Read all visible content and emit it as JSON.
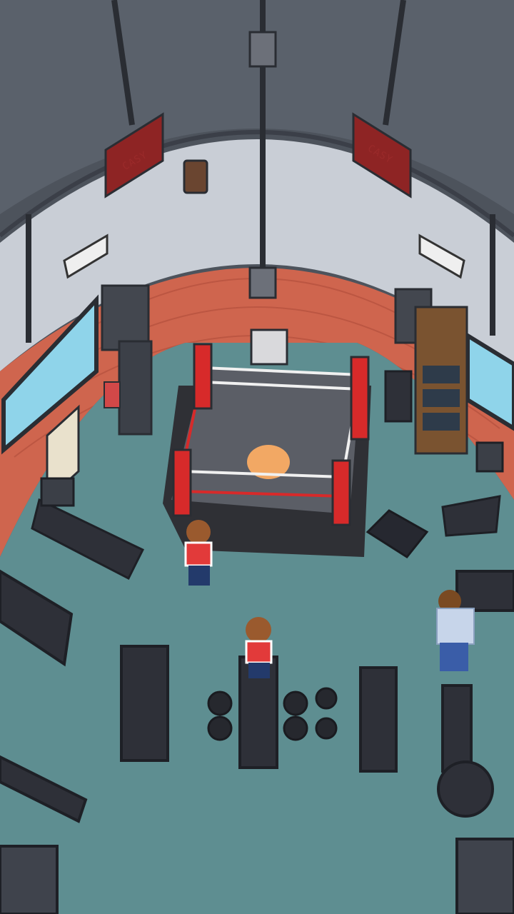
{
  "scene": {
    "type": "isometric-pixel-gym",
    "signs": [
      {
        "name": "left-wall-sign",
        "text": "CASY"
      },
      {
        "name": "right-wall-sign",
        "text": "CASY"
      }
    ],
    "colors": {
      "ceiling": "#555c66",
      "wall_upper": "#c9ced6",
      "brick": "#d0664f",
      "floor": "#5f8f92",
      "ring_mat": "#5b5e66",
      "ring_rope_red": "#d72a2a",
      "ring_center": "#f2a864",
      "equipment_dark": "#2e3038"
    },
    "characters": [
      {
        "name": "boxer-by-ring",
        "shirt": "red-white"
      },
      {
        "name": "player-on-bench",
        "shirt": "red-white"
      },
      {
        "name": "gym-member-right",
        "shirt": "light-blue"
      }
    ]
  }
}
